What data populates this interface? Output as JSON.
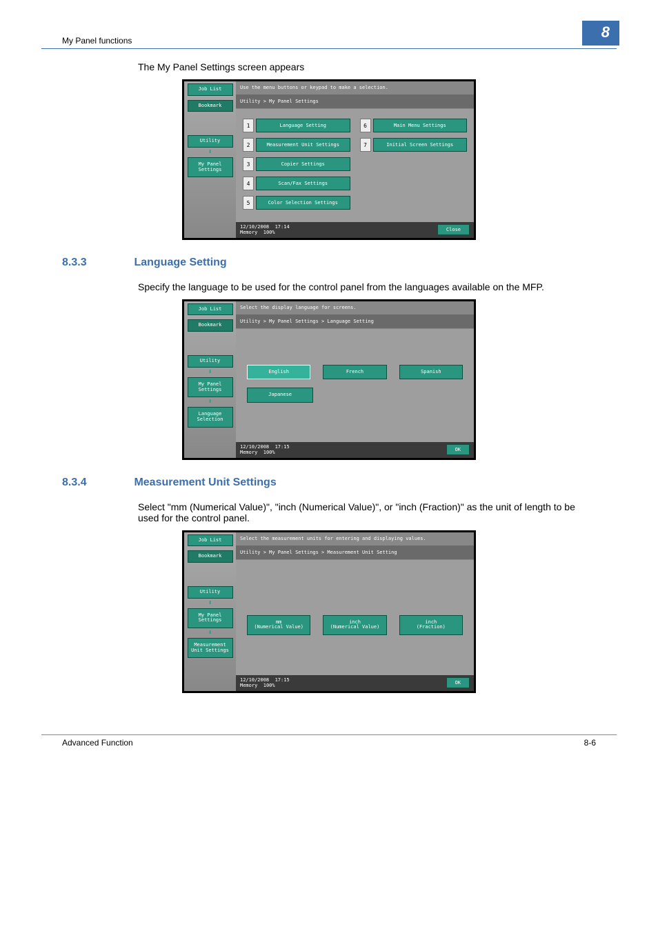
{
  "header": {
    "section": "My Panel functions",
    "chapter": "8"
  },
  "intro": {
    "line": "The My Panel Settings screen appears"
  },
  "panel1": {
    "side": {
      "job_list": "Job List",
      "bookmark": "Bookmark",
      "utility": "Utility",
      "my_panel": "My Panel\nSettings"
    },
    "instruction": "Use the menu buttons or keypad to make a selection.",
    "breadcrumb": "Utility > My Panel Settings",
    "menu": [
      {
        "num": "1",
        "label": "Language Setting"
      },
      {
        "num": "2",
        "label": "Measurement Unit Settings"
      },
      {
        "num": "3",
        "label": "Copier Settings"
      },
      {
        "num": "4",
        "label": "Scan/Fax Settings"
      },
      {
        "num": "5",
        "label": "Color Selection Settings"
      },
      {
        "num": "6",
        "label": "Main Menu Settings"
      },
      {
        "num": "7",
        "label": "Initial Screen Settings"
      }
    ],
    "status": {
      "date": "12/10/2008",
      "time": "17:14",
      "mem_label": "Memory",
      "mem_val": "100%",
      "close": "Close"
    }
  },
  "sec833": {
    "num": "8.3.3",
    "title": "Language Setting",
    "desc": "Specify the language to be used for the control panel from the languages available on the MFP."
  },
  "panel2": {
    "side": {
      "job_list": "Job List",
      "bookmark": "Bookmark",
      "utility": "Utility",
      "my_panel": "My Panel\nSettings",
      "lang_sel": "Language\nSelection"
    },
    "instruction": "Select the display language for screens.",
    "breadcrumb": "Utility > My Panel Settings > Language Setting",
    "options1": [
      "English",
      "French",
      "Spanish"
    ],
    "options2": [
      "Japanese"
    ],
    "status": {
      "date": "12/10/2008",
      "time": "17:15",
      "mem_label": "Memory",
      "mem_val": "100%",
      "ok": "OK"
    }
  },
  "sec834": {
    "num": "8.3.4",
    "title": "Measurement Unit Settings",
    "desc": "Select \"mm (Numerical Value)\", \"inch (Numerical Value)\", or \"inch (Fraction)\" as the unit of length to be used for the control panel."
  },
  "panel3": {
    "side": {
      "job_list": "Job List",
      "bookmark": "Bookmark",
      "utility": "Utility",
      "my_panel": "My Panel\nSettings",
      "unit_set": "Measurement\nUnit Settings"
    },
    "instruction": "Select the measurement units for entering and displaying values.",
    "breadcrumb": "Utility > My Panel Settings > Measurement Unit Setting",
    "options": [
      "mm\n(Numerical Value)",
      "inch\n(Numerical Value)",
      "inch\n(Fraction)"
    ],
    "status": {
      "date": "12/10/2008",
      "time": "17:15",
      "mem_label": "Memory",
      "mem_val": "100%",
      "ok": "OK"
    }
  },
  "footer": {
    "left": "Advanced Function",
    "right": "8-6"
  }
}
